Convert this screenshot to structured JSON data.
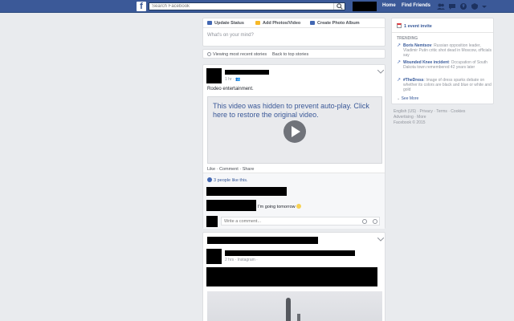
{
  "topbar": {
    "logo": "f",
    "search_placeholder": "Search Facebook",
    "home": "Home",
    "find_friends": "Find Friends",
    "bg_color": "#3b5998"
  },
  "composer": {
    "tab_status": "Update Status",
    "tab_photo": "Add Photos/Video",
    "tab_album": "Create Photo Album",
    "placeholder": "What's on your mind?"
  },
  "viewbar": {
    "viewing": "Viewing most recent stories",
    "back": "Back to top stories"
  },
  "post1": {
    "time": "1 hr",
    "text": "Rodeo entertainment.",
    "video_message": "This video was hidden to prevent auto-play. Click here to restore the original video.",
    "actions": "Like · Comment · Share",
    "likes": "3 people like this.",
    "comment": "I'm going tomorrow",
    "comment_placeholder": "Write a comment..."
  },
  "post2": {
    "meta": "2 hrs · Instagram ·"
  },
  "sidebar": {
    "event": "1 event invite",
    "trending_heading": "TRENDING",
    "trends": [
      {
        "title": "Boris Nemtsov",
        "desc": ": Russian opposition leader, Vladimir Putin critic shot dead in Moscow, officials say"
      },
      {
        "title": "Wounded Knee incident",
        "desc": ": Occupation of South Dakota town remembered 42 years later"
      },
      {
        "title": "#TheDress",
        "desc": ": Image of dress sparks debate on whether its colors are black and blue or white and gold"
      }
    ],
    "see_more": "See More"
  },
  "footer": {
    "line1": "English (US) · Privacy · Terms · Cookies",
    "line2": "Advertising · More",
    "line3": "Facebook © 2015"
  }
}
